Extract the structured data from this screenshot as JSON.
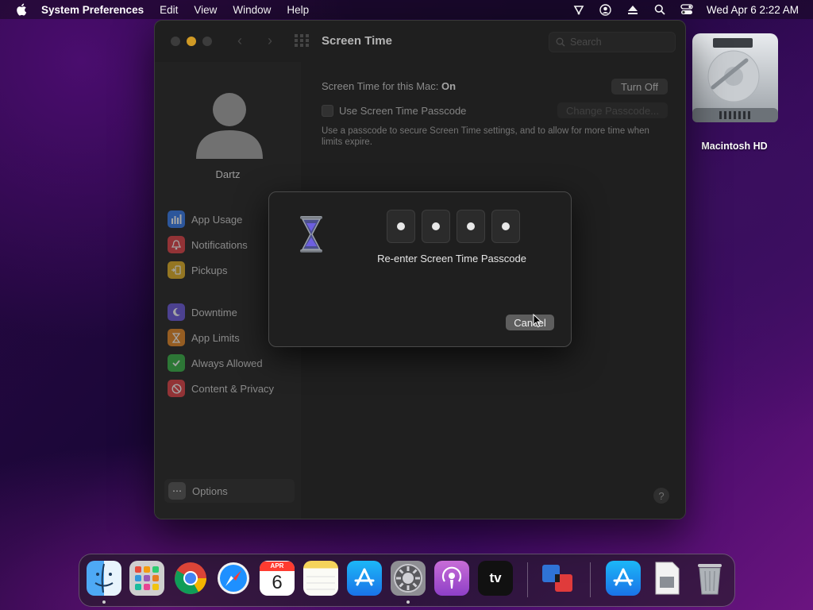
{
  "menubar": {
    "app_name": "System Preferences",
    "items": [
      "Edit",
      "View",
      "Window",
      "Help"
    ],
    "clock": "Wed Apr 6  2:22 AM",
    "status_icons": [
      "wifi-icon",
      "user-icon",
      "eject-icon",
      "spotlight-search-icon",
      "control-center-icon"
    ]
  },
  "window": {
    "title": "Screen Time",
    "search_placeholder": "Search"
  },
  "sidebar": {
    "username": "Dartz",
    "items": [
      {
        "label": "App Usage",
        "icon": "bar-chart-icon",
        "color": "#3b7ff0"
      },
      {
        "label": "Notifications",
        "icon": "bell-icon",
        "color": "#e0464a"
      },
      {
        "label": "Pickups",
        "icon": "pickup-icon",
        "color": "#e4b42b"
      },
      {
        "label": "Downtime",
        "icon": "moon-icon",
        "color": "#6e5ddd"
      },
      {
        "label": "App Limits",
        "icon": "hourglass-icon",
        "color": "#e58a2a"
      },
      {
        "label": "Always Allowed",
        "icon": "checkmark-shield-icon",
        "color": "#3db54a"
      },
      {
        "label": "Content & Privacy",
        "icon": "no-entry-icon",
        "color": "#e0464a"
      }
    ],
    "options_label": "Options"
  },
  "main": {
    "status_prefix": "Screen Time for this Mac:",
    "status_value": "On",
    "turn_off_label": "Turn Off",
    "passcode_checkbox_label": "Use Screen Time Passcode",
    "change_passcode_label": "Change Passcode...",
    "description": "Use a passcode to secure Screen Time settings, and to allow for more time when limits expire.",
    "help_label": "?"
  },
  "sheet": {
    "pin_digits_entered": 4,
    "label": "Re-enter Screen Time Passcode",
    "cancel_label": "Cancel"
  },
  "desktop": {
    "drive_label": "Macintosh HD"
  },
  "dock": {
    "apps": [
      {
        "name": "finder-icon",
        "running": true
      },
      {
        "name": "launchpad-icon",
        "running": false
      },
      {
        "name": "chrome-icon",
        "running": false
      },
      {
        "name": "safari-icon",
        "running": false
      },
      {
        "name": "calendar-icon",
        "running": false,
        "month": "APR",
        "day": "6"
      },
      {
        "name": "notes-icon",
        "running": false
      },
      {
        "name": "app-store-icon",
        "running": false
      },
      {
        "name": "system-preferences-icon",
        "running": true
      },
      {
        "name": "podcasts-icon",
        "running": false
      },
      {
        "name": "apple-tv-icon",
        "running": false,
        "text": "tv"
      },
      {
        "name": "parallels-icon",
        "running": false
      },
      {
        "name": "app-store-downloads-icon",
        "running": false
      },
      {
        "name": "document-stack-icon",
        "running": false
      },
      {
        "name": "trash-icon",
        "running": false
      }
    ]
  }
}
